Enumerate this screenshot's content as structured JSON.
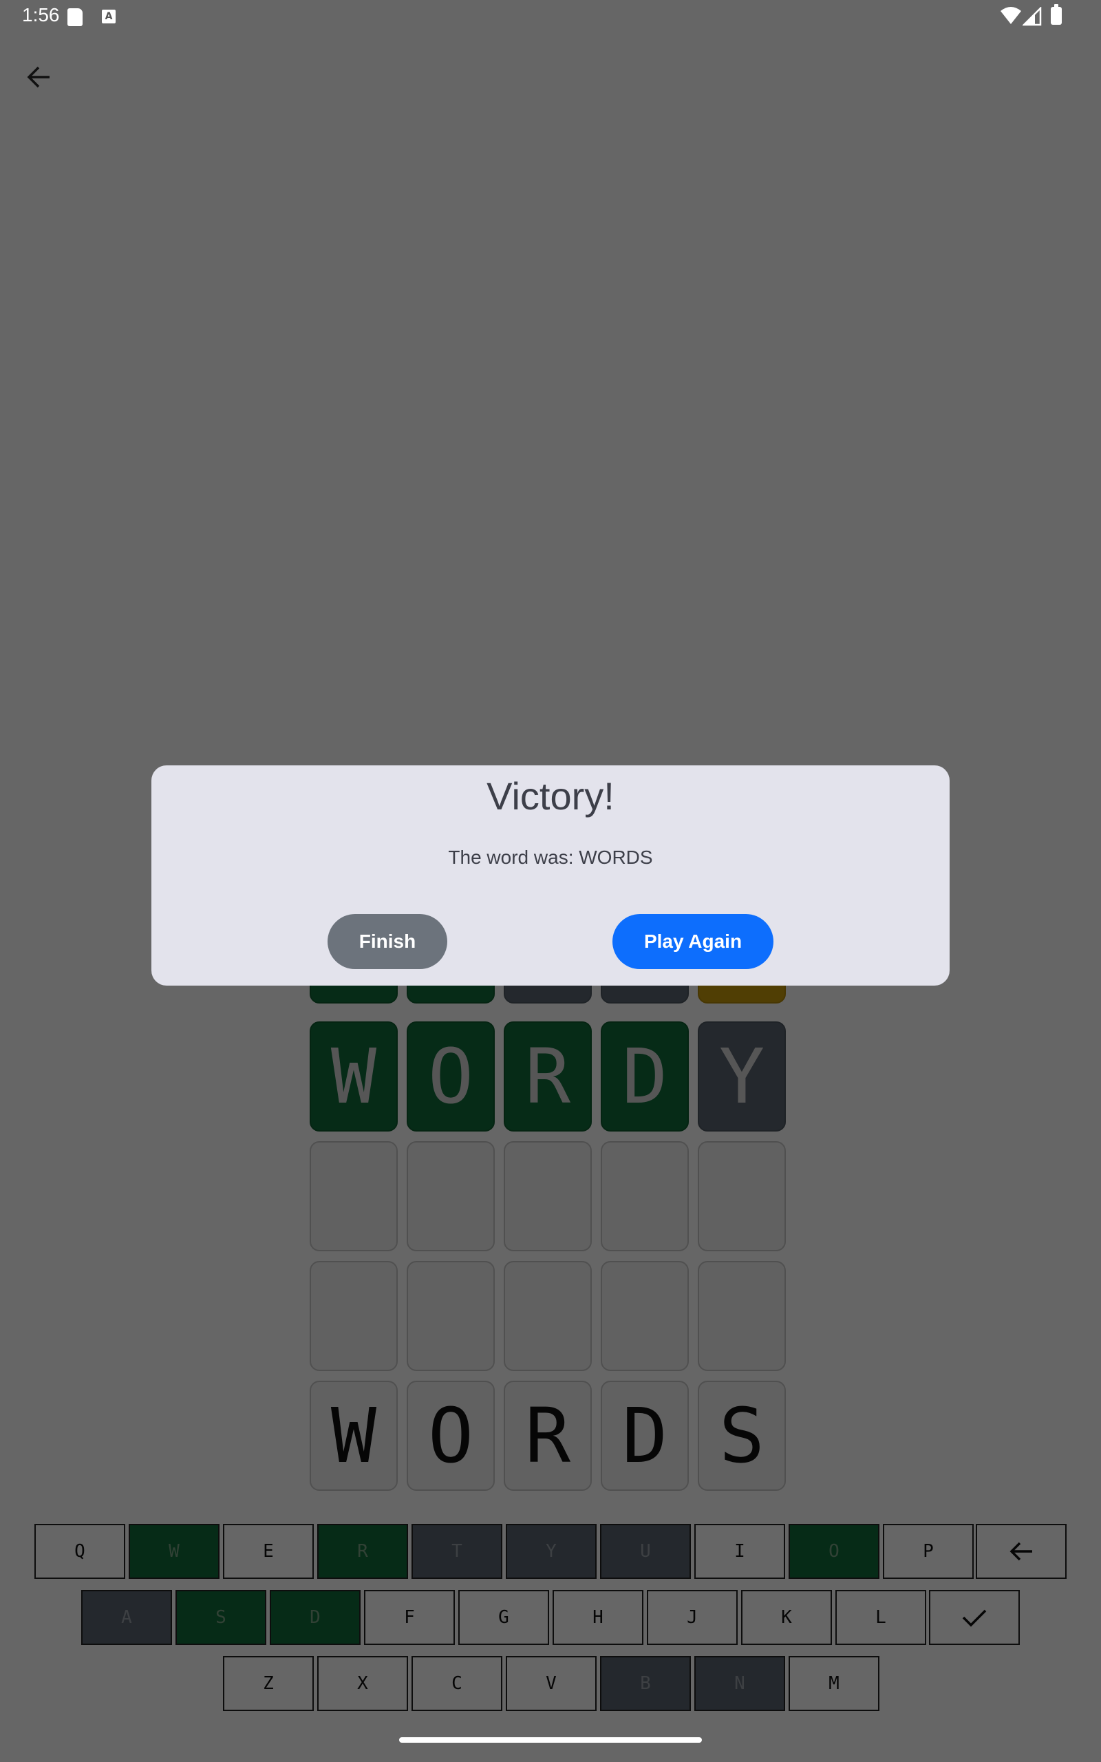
{
  "status_bar": {
    "time": "1:56",
    "a_icon_letter": "A"
  },
  "board": {
    "rows": [
      {
        "letters": [
          "",
          "",
          "",
          "",
          ""
        ],
        "states": [
          "correct",
          "correct",
          "absent",
          "absent",
          "present"
        ]
      },
      {
        "letters": [
          "W",
          "O",
          "R",
          "D",
          "Y"
        ],
        "states": [
          "correct",
          "correct",
          "correct",
          "correct",
          "absent"
        ]
      },
      {
        "letters": [
          "",
          "",
          "",
          "",
          ""
        ],
        "states": [
          "empty",
          "empty",
          "empty",
          "empty",
          "empty"
        ]
      },
      {
        "letters": [
          "",
          "",
          "",
          "",
          ""
        ],
        "states": [
          "empty",
          "empty",
          "empty",
          "empty",
          "empty"
        ]
      },
      {
        "letters": [
          "W",
          "O",
          "R",
          "D",
          "S"
        ],
        "states": [
          "empty",
          "empty",
          "empty",
          "empty",
          "empty"
        ]
      }
    ]
  },
  "keyboard": {
    "row1": [
      {
        "label": "Q",
        "state": "none"
      },
      {
        "label": "W",
        "state": "correct"
      },
      {
        "label": "E",
        "state": "none"
      },
      {
        "label": "R",
        "state": "correct"
      },
      {
        "label": "T",
        "state": "absent"
      },
      {
        "label": "Y",
        "state": "absent"
      },
      {
        "label": "U",
        "state": "absent"
      },
      {
        "label": "I",
        "state": "none"
      },
      {
        "label": "O",
        "state": "correct"
      },
      {
        "label": "P",
        "state": "none"
      }
    ],
    "row2": [
      {
        "label": "A",
        "state": "absent"
      },
      {
        "label": "S",
        "state": "correct"
      },
      {
        "label": "D",
        "state": "correct"
      },
      {
        "label": "F",
        "state": "none"
      },
      {
        "label": "G",
        "state": "none"
      },
      {
        "label": "H",
        "state": "none"
      },
      {
        "label": "J",
        "state": "none"
      },
      {
        "label": "K",
        "state": "none"
      },
      {
        "label": "L",
        "state": "none"
      }
    ],
    "row3": [
      {
        "label": "Z",
        "state": "none"
      },
      {
        "label": "X",
        "state": "none"
      },
      {
        "label": "C",
        "state": "none"
      },
      {
        "label": "V",
        "state": "none"
      },
      {
        "label": "B",
        "state": "absent"
      },
      {
        "label": "N",
        "state": "absent"
      },
      {
        "label": "M",
        "state": "none"
      }
    ]
  },
  "dialog": {
    "title": "Victory!",
    "message": "The word was: WORDS",
    "finish_label": "Finish",
    "play_again_label": "Play Again"
  },
  "colors": {
    "correct": "#116d3a",
    "absent": "#5b6470",
    "present": "#c79b0a",
    "primary_button": "#0d6efd",
    "secondary_button": "#6c737c",
    "dialog_bg": "#e3e3ec"
  }
}
